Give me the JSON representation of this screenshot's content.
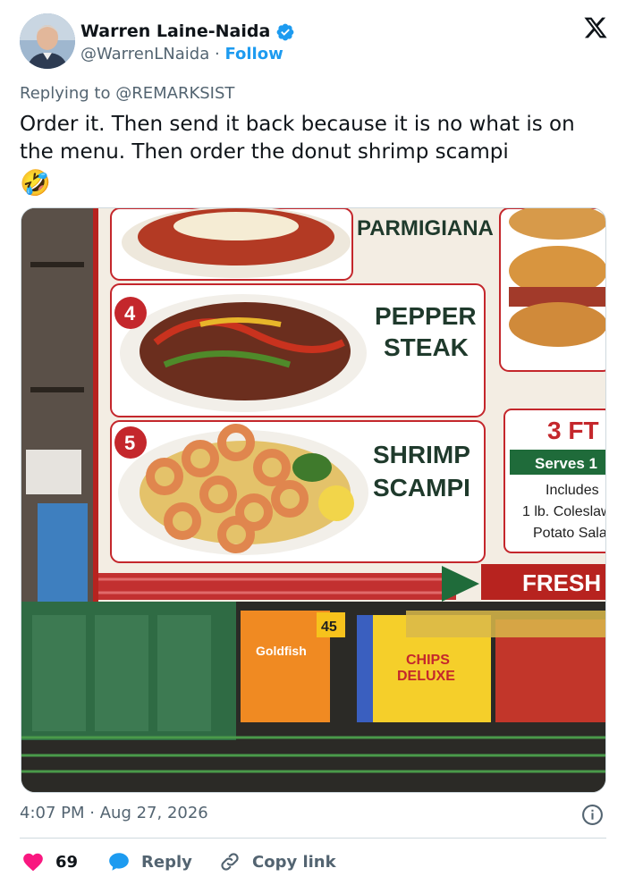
{
  "author": {
    "name": "Warren Laine-Naida",
    "handle": "@WarrenLNaida",
    "separator": "·",
    "follow_label": "Follow",
    "verified": true
  },
  "reply_context": {
    "prefix": "Replying to",
    "target": "@REMARKSIST"
  },
  "tweet": {
    "text": "Order it. Then send it back because it is no what is on the menu. Then order the donut shrimp scampi",
    "emoji": "🤣"
  },
  "media": {
    "menu_items": [
      {
        "name": "PARMIGIANA"
      },
      {
        "number": "4",
        "name_line1": "PEPPER",
        "name_line2": "STEAK"
      },
      {
        "number": "5",
        "name_line1": "SHRIMP",
        "name_line2": "SCAMPI"
      }
    ],
    "side_panel": {
      "title": "3 FT",
      "serves": "Serves 1",
      "includes": "Includes",
      "line1": "1 lb. Coleslaw",
      "line2": "Potato Sala"
    },
    "fresh_banner": "FRESH",
    "shelf_labels": [
      "45",
      "Goldfish",
      "CHIPS",
      "DELUXE"
    ]
  },
  "meta": {
    "time": "4:07 PM",
    "date": "Aug 27, 2026",
    "separator": "·"
  },
  "actions": {
    "like_count": "69",
    "reply_label": "Reply",
    "copy_label": "Copy link"
  },
  "colors": {
    "accent": "#1d9bf0",
    "like": "#f91880",
    "muted": "#536471",
    "menu_red": "#c4272c",
    "menu_green": "#1f6b3a"
  }
}
